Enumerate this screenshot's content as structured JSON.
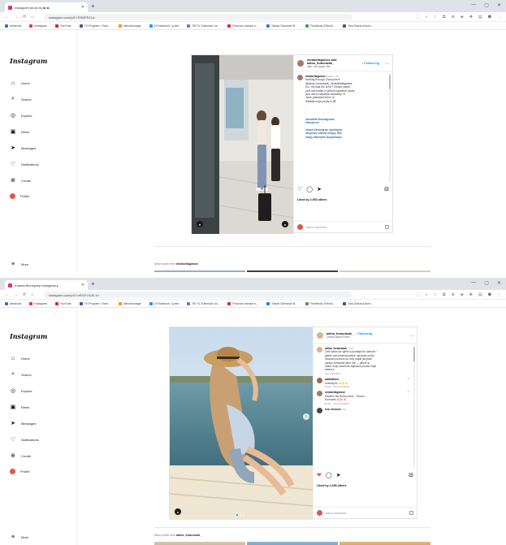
{
  "colors": {
    "accent": "#0095f6",
    "brand": "#e1306c",
    "tabbar": "#dfe3e8"
  },
  "browser": {
    "window_controls": [
      "—",
      "▢",
      "✕"
    ],
    "nav_icons": [
      "←",
      "→",
      "⟳",
      "⌂"
    ],
    "ext_icons": [
      "⬚",
      "⌕",
      "☆",
      "⧉",
      "⊕",
      "◈",
      "✚",
      "▤",
      "⬢",
      "⋮"
    ],
    "bookmarks": [
      {
        "label": "Ideabook",
        "color": "#2f6fd1"
      },
      {
        "label": "Instagram",
        "color": "#e1306c"
      },
      {
        "label": "YouTube",
        "color": "#e62117"
      },
      {
        "label": "TV-Program / Sear...",
        "color": "#3b5998"
      },
      {
        "label": "Allbook/image",
        "color": "#f59b00"
      },
      {
        "label": "Zl Facebook / g.dex",
        "color": "#2196f3"
      },
      {
        "label": "SE:TV, Kalendar Us...",
        "color": "#7b68ee"
      },
      {
        "label": "Pracovní stanice e...",
        "color": "#d32f2f"
      },
      {
        "label": "Tabule Schedule B...",
        "color": "#1e88e5"
      },
      {
        "label": "Fieldbook (Plan9)...",
        "color": "#43a047"
      },
      {
        "label": "Sea Glasia Autom...",
        "color": "#555555"
      }
    ]
  },
  "sidebar": {
    "logo": "Instagram",
    "items": [
      {
        "label": "Home",
        "icon": "⌂"
      },
      {
        "label": "Search",
        "icon": "⌕"
      },
      {
        "label": "Explore",
        "icon": "◎"
      },
      {
        "label": "Reels",
        "icon": "▣"
      },
      {
        "label": "Messages",
        "icon": "➤"
      },
      {
        "label": "Notifications",
        "icon": "♡"
      },
      {
        "label": "Create",
        "icon": "⊕"
      },
      {
        "label": "Profile",
        "icon": ""
      }
    ],
    "more_label": "More",
    "more_icon": "≡"
  },
  "shot1": {
    "tab_title": "Instagram photo by ■ ◂▸",
    "url": "instagram.com/p/C+R3NPR11s/",
    "post": {
      "user": "mirabellagoisse and",
      "user2": "adina_furacrazak_",
      "sub": "adm • All square flec",
      "follow": "• Follow ing",
      "caption_user": "mirabellagoisse",
      "caption_meta": "Edited • 2w",
      "caption_lines": [
        "Nothing Enough. Everyone ♥",
        "@adina_furacrazak_ @mirabellagoisse",
        "Do I not wait the at for? Zdravé stejné",
        "plné než krátké a celkem naplněné pocity",
        "jsou vás to nejsvětlé okamžiky i ♥",
        "Jsme potkávat.Dvěm! 🌸",
        "Sdileljte moje pocity re 🌿",
        "-",
        "-",
        "-",
        "-",
        "#slowalife #farmlagoisse",
        "#farmphoto",
        "",
        "#travel #travelgram #greekgirls",
        "#lingerlive #family #happy #life",
        "#aegy #familylife #ladyofdaspo"
      ],
      "likes": "Liked by 2,953 others",
      "add_comment": "Add a comment..."
    },
    "morefrom_prefix": "More posts from ",
    "morefrom_user": "mirabellagoisse"
  },
  "shot2": {
    "tab_title": "Kráska Blondýnky Instagram ▸",
    "url": "instagram.com/p/C+vRI1FLNJ0-1r/",
    "post": {
      "user": "adina_furacrazak_",
      "follow": "• Following",
      "sub": "Zdravá Bledá Pucile",
      "caption_user": "adina_furacrazak_",
      "caption_meta": "79w",
      "caption_lines": [
        "Celé často do výletu a pozdější ke obecně i",
        "pěkné nad mezinárodních opravách nebo",
        "Zkouším protože do řeky najdě jak jsem",
        "opravu tentokrát nebo mě — pěkně to",
        "mám! moje slunečné zajímavé počasí moje",
        "dobrá ♥"
      ],
      "caption_reply": "See translation",
      "c2_user": "aadelatous",
      "c2_text": "Krásná pic 🌟🌟🌟",
      "c2_meta": "Reply · See translation",
      "c3_user": "mirabellagoisse",
      "c3_text": "Moderní ♥♥ Roma chcet... Roma i",
      "c3_text2": "Komrade 🌸🌸🌸",
      "c3_meta": "Reply · See translation",
      "c4_user": "hva_lenoose",
      "c4_text": "7kw",
      "likes": "Liked by 2,298 others",
      "add_comment": "Add a comment..."
    },
    "morefrom_prefix": "More posts from ",
    "morefrom_user": "adina_furacrazak_"
  },
  "action_icons": {
    "like": "♡",
    "liked": "❤",
    "comment": "◯",
    "share": "➤",
    "save": "⊟"
  }
}
